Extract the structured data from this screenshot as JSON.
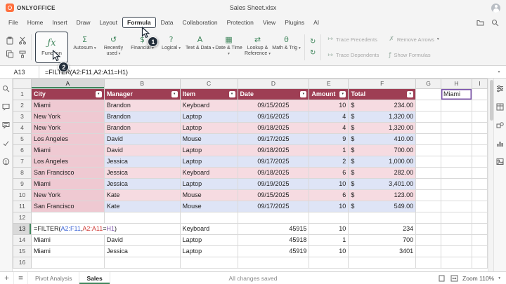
{
  "titlebar": {
    "brand": "ONLYOFFICE",
    "doc_title": "Sales Sheet.xlsx"
  },
  "menubar": {
    "tabs": [
      "File",
      "Home",
      "Insert",
      "Draw",
      "Layout",
      "Formula",
      "Data",
      "Collaboration",
      "Protection",
      "View",
      "Plugins",
      "AI"
    ],
    "active_tab": "Formula"
  },
  "ribbon": {
    "function_button": {
      "label": "Function",
      "icon": "function-fx-icon",
      "glyph": "ƒx"
    },
    "categories": [
      {
        "label": "Autosum",
        "icon": "autosum-icon",
        "glyph": "Σ"
      },
      {
        "label": "Recently used",
        "icon": "recently-used-icon",
        "glyph": "↺"
      },
      {
        "label": "Financial",
        "icon": "financial-icon",
        "glyph": "$"
      },
      {
        "label": "Logical",
        "icon": "logical-icon",
        "glyph": "?"
      },
      {
        "label": "Text & Data",
        "icon": "text-data-icon",
        "glyph": "A"
      },
      {
        "label": "Date & Time",
        "icon": "date-time-icon",
        "glyph": "▦"
      },
      {
        "label": "Lookup & Reference",
        "icon": "lookup-reference-icon",
        "glyph": "⇄"
      },
      {
        "label": "Math & Trig",
        "icon": "math-trig-icon",
        "glyph": "θ"
      }
    ],
    "calc_buttons": [
      {
        "icon": "calculate-sheet-icon",
        "glyph": "↻"
      },
      {
        "icon": "calculate-workbook-icon",
        "glyph": "↻"
      }
    ],
    "analysis": [
      {
        "label": "Trace Precedents",
        "icon": "trace-precedents-icon",
        "glyph": "↦",
        "chevron": false
      },
      {
        "label": "Trace Dependents",
        "icon": "trace-dependents-icon",
        "glyph": "↦",
        "chevron": false
      },
      {
        "label": "Remove Arrows",
        "icon": "remove-arrows-icon",
        "glyph": "✗",
        "chevron": true
      },
      {
        "label": "Show Formulas",
        "icon": "show-formulas-icon",
        "glyph": "ƒ",
        "chevron": false
      }
    ]
  },
  "formula_bar": {
    "cell_ref": "A13",
    "formula": "=FILTER(A2:F11,A2:A11=H1)"
  },
  "grid": {
    "column_letters": [
      "A",
      "B",
      "C",
      "D",
      "E",
      "F",
      "G",
      "H",
      "I"
    ],
    "header_row": [
      "City",
      "Manager",
      "Item",
      "Date",
      "Amount",
      "Total"
    ],
    "currency_symbol": "$",
    "data_rows": [
      [
        "Miami",
        "Brandon",
        "Keyboard",
        "09/15/2025",
        "10",
        "234.00"
      ],
      [
        "New York",
        "Brandon",
        "Laptop",
        "09/16/2025",
        "4",
        "1,320.00"
      ],
      [
        "New York",
        "Brandon",
        "Laptop",
        "09/18/2025",
        "4",
        "1,320.00"
      ],
      [
        "Los Angeles",
        "David",
        "Mouse",
        "09/17/2025",
        "9",
        "410.00"
      ],
      [
        "Miami",
        "David",
        "Laptop",
        "09/18/2025",
        "1",
        "700.00"
      ],
      [
        "Los Angeles",
        "Jessica",
        "Laptop",
        "09/17/2025",
        "2",
        "1,000.00"
      ],
      [
        "San Francisco",
        "Jessica",
        "Keyboard",
        "09/18/2025",
        "6",
        "282.00"
      ],
      [
        "Miami",
        "Jessica",
        "Laptop",
        "09/19/2025",
        "10",
        "3,401.00"
      ],
      [
        "New York",
        "Kate",
        "Mouse",
        "09/15/2025",
        "6",
        "123.00"
      ],
      [
        "San Francisco",
        "Kate",
        "Mouse",
        "09/17/2025",
        "10",
        "549.00"
      ]
    ],
    "h1_value": "Miami",
    "formula_cell_parts": [
      {
        "text": "=FILTER(",
        "color": "plain"
      },
      {
        "text": "A2:F11",
        "color": "blue"
      },
      {
        "text": ",",
        "color": "plain"
      },
      {
        "text": "A2:A11",
        "color": "red"
      },
      {
        "text": "=",
        "color": "plain"
      },
      {
        "text": "H1",
        "color": "purple"
      },
      {
        "text": ")",
        "color": "plain"
      }
    ],
    "result_rows": [
      [
        "",
        "",
        "Keyboard",
        "45915",
        "10",
        "234"
      ],
      [
        "Miami",
        "David",
        "Laptop",
        "45918",
        "1",
        "700"
      ],
      [
        "Miami",
        "Jessica",
        "Laptop",
        "45919",
        "10",
        "3401"
      ]
    ]
  },
  "statusbar": {
    "sheet_tabs": [
      "Pivot Analysis",
      "Sales"
    ],
    "active_sheet": "Sales",
    "message": "All changes saved",
    "zoom": "Zoom 110%",
    "add_sheet_glyph": "+",
    "sheet_list_glyph": "≡"
  },
  "annotations": {
    "step1": "1",
    "step2": "2"
  },
  "icons": {
    "chevron_down": "▾",
    "filter": "▾"
  },
  "colors": {
    "brand_orange": "#ff6f3d",
    "header_bg": "#9e3e54",
    "row_pink": "#f6dbe1",
    "row_lavender": "#dee4f6",
    "col_a_bg": "#efc9d2",
    "ref_blue": "#3e66d6",
    "ref_red": "#d03a34",
    "ref_purple": "#7b52ab",
    "badge_bg": "#232e3a",
    "highlight": "#39434f",
    "icon_green": "#40865c",
    "accent_green": "#40865c"
  }
}
